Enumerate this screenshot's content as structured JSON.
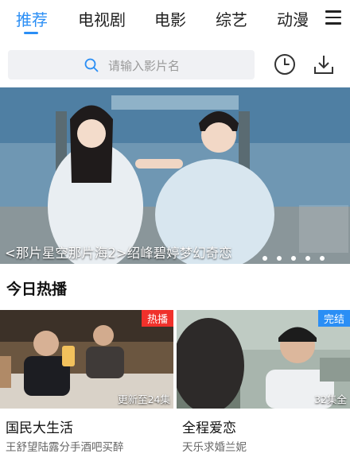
{
  "tabs": [
    {
      "label": "推荐",
      "active": true
    },
    {
      "label": "电视剧",
      "active": false
    },
    {
      "label": "电影",
      "active": false
    },
    {
      "label": "综艺",
      "active": false
    },
    {
      "label": "动漫",
      "active": false
    }
  ],
  "icons": {
    "menu": "hamburger-menu-icon",
    "search": "search-icon",
    "history": "clock-history-icon",
    "download": "download-icon"
  },
  "search": {
    "placeholder": "请输入影片名"
  },
  "banner": {
    "caption": "<那片星空那片海2>绍峰碧婷梦幻奇恋",
    "poster_text": "那片星空那片海",
    "slide_count": 5,
    "active_slide": 5
  },
  "section": {
    "title": "今日热播"
  },
  "cards": [
    {
      "badge": "热播",
      "badge_color": "#f0312b",
      "episodes": "更新至24集",
      "title": "国民大生活",
      "subtitle": "王舒望陆露分手酒吧买醉"
    },
    {
      "badge": "完结",
      "badge_color": "#2a8ef5",
      "episodes": "32集全",
      "title": "全程爱恋",
      "subtitle": "天乐求婚兰妮"
    }
  ],
  "colors": {
    "accent": "#2a8ef5",
    "hot": "#f0312b",
    "finished": "#2a8ef5"
  }
}
